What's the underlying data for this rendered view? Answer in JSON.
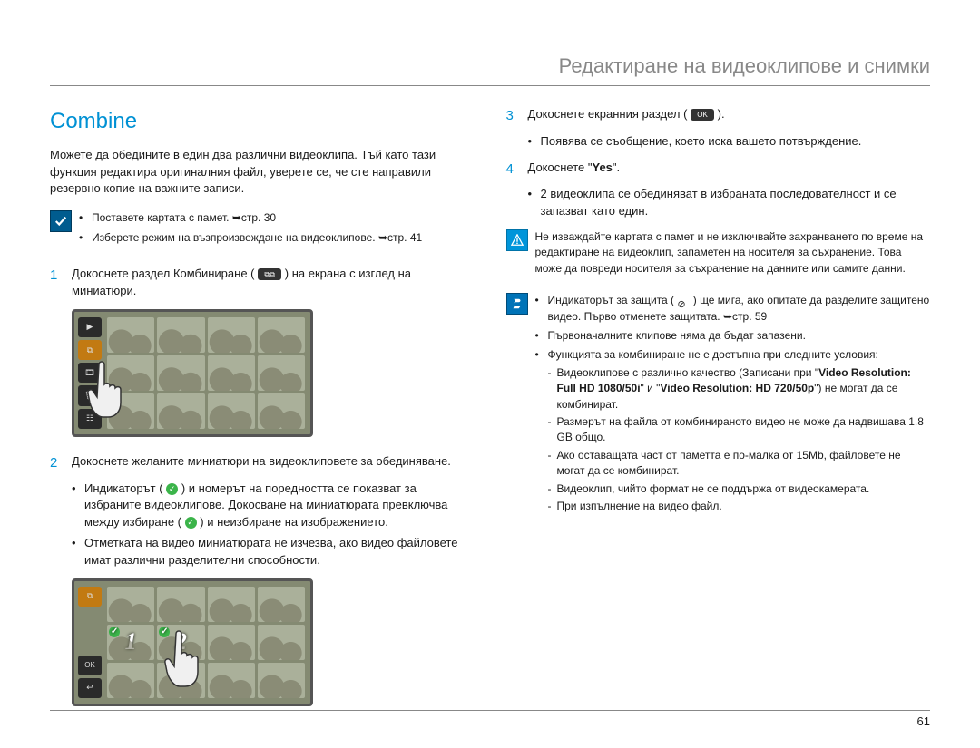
{
  "header": {
    "title": "Редактиране на видеоклипове и снимки"
  },
  "section_heading": "Combine",
  "intro": "Можете да обедините в един два различни видеоклипа. Тъй като тази функция редактира оригиналния файл, уверете се, че сте направили резервно копие на важните записи.",
  "prep": {
    "items": [
      "Поставете картата с памет. ➥стр. 30",
      "Изберете режим на възпроизвеждане на видеоклипове. ➥стр. 41"
    ]
  },
  "left_steps": [
    {
      "num": "1",
      "text_before": "Докоснете раздел Комбиниране (",
      "text_after": ") на екрана с изглед на миниатюри."
    },
    {
      "num": "2",
      "text": "Докоснете желаните миниатюри на видеоклиповете за обединяване.",
      "subs": [
        {
          "before": "Индикаторът (",
          "mid": ") и номерът на поредността се показват за избраните видеоклипове. Докосване на миниатюрата превключва между избиране (",
          "after": ") и неизбиране на изображението."
        },
        {
          "plain": "Отметката на видео миниатюрата не изчезва, ако видео файловете имат различни разделителни способности."
        }
      ]
    }
  ],
  "right_steps": [
    {
      "num": "3",
      "text_before": "Докоснете екранния раздел (",
      "ok_label": "OK",
      "text_after": ").",
      "subs": [
        {
          "plain": "Появява се съобщение, което иска вашето потвърждение."
        }
      ]
    },
    {
      "num": "4",
      "text_before": "Докоснете \"",
      "bold": "Yes",
      "text_after": "\".",
      "subs": [
        {
          "plain": "2 видеоклипа се обединяват в избраната последователност и се запазват като един."
        }
      ]
    }
  ],
  "warning": "Не изваждайте картата с памет и не изключвайте захранването по време на редактиране на видеоклип, запаметен на носителя за съхранение. Това може да повреди носителя за съхранение на данните или самите данни.",
  "info": {
    "items": [
      {
        "before": "Индикаторът за защита (",
        "after": ") ще мига, ако опитате да разделите защитено видео. Първо отменете защитата. ➥стр. 59"
      },
      {
        "plain": "Първоначалните клипове няма да бъдат запазени."
      },
      {
        "plain": "Функцията за комбиниране не е достъпна при следните условия:",
        "subsub": [
          {
            "b1": "Видеоклипове с различно качество (Записани при \"",
            "bold1": "Video Resolution: Full HD 1080/50i",
            "mid": "\" и \"",
            "bold2": "Video Resolution: HD 720/50p",
            "b2": "\") не могат да се комбинират."
          },
          {
            "plain": "Размерът на файла от комбинираното видео не може да надвишава 1.8 GB общо."
          },
          {
            "plain": "Ако оставащата част от паметта е по-малка от 15Mb, файловете не могат да се комбинират."
          },
          {
            "plain": "Видеоклип, чийто формат не се поддържа от видеокамерата."
          },
          {
            "plain": "При изпълнение на видео файл."
          }
        ]
      }
    ]
  },
  "screenshot2": {
    "sel1": "1",
    "sel2": "2",
    "ok": "OK",
    "back": "↩"
  },
  "page_number": "61"
}
